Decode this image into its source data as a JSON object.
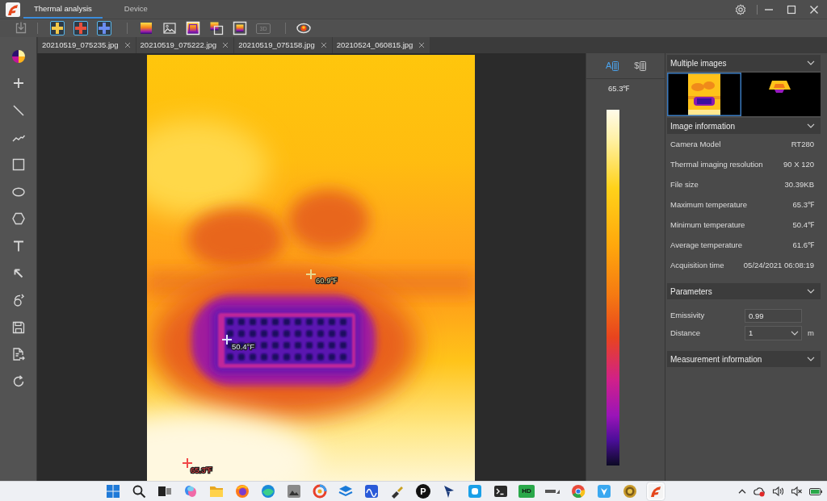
{
  "window": {
    "tabs": [
      {
        "label": "Thermal analysis",
        "selected": true
      },
      {
        "label": "Device",
        "selected": false
      }
    ]
  },
  "toolbar": {
    "groups": [
      {
        "buttons": [
          {
            "kind": "import",
            "disabled": true
          }
        ]
      },
      {
        "buttons": [
          {
            "kind": "add",
            "color": "#f2c84a",
            "disabled": false
          },
          {
            "kind": "add",
            "color": "#e8503c",
            "disabled": false
          },
          {
            "kind": "add",
            "color": "#6a8cf0",
            "disabled": false
          }
        ]
      },
      {
        "buttons": [
          {
            "kind": "palette",
            "disabled": false
          },
          {
            "kind": "image",
            "disabled": false
          },
          {
            "kind": "frame",
            "disabled": false
          },
          {
            "kind": "overlay",
            "disabled": false
          },
          {
            "kind": "inset",
            "disabled": false
          },
          {
            "kind": "badge",
            "label": "3D",
            "disabled": true
          }
        ]
      },
      {
        "buttons": [
          {
            "kind": "fusion",
            "disabled": false
          }
        ]
      }
    ]
  },
  "file_tabs": [
    {
      "label": "20210519_075235.jpg"
    },
    {
      "label": "20210519_075222.jpg"
    },
    {
      "label": "20210519_075158.jpg"
    },
    {
      "label": "20210524_060815.jpg"
    }
  ],
  "measurements": [
    {
      "kind": "center",
      "label": "60.9℉",
      "color": "#e8d890"
    },
    {
      "kind": "min",
      "label": "50.4°F",
      "color": "#dfe4ff"
    },
    {
      "kind": "max",
      "label": "65.3℉",
      "color": "#f04848"
    }
  ],
  "color_scale": {
    "modes": [
      {
        "label": "A",
        "selected": true
      },
      {
        "label": "$",
        "selected": false
      }
    ],
    "max_label": "65.3℉"
  },
  "side_panel": {
    "sections": [
      {
        "kind": "images",
        "title": "Multiple images",
        "thumbnails": [
          {
            "kind": "portrait",
            "selected": true
          },
          {
            "kind": "object",
            "selected": false
          }
        ]
      },
      {
        "kind": "info",
        "title": "Image information",
        "rows": [
          {
            "label": "Camera Model",
            "value": "RT280"
          },
          {
            "label": "Thermal imaging resolution",
            "value": "90 X 120"
          },
          {
            "label": "File size",
            "value": "30.39KB"
          },
          {
            "label": "Maximum temperature",
            "value": "65.3℉"
          },
          {
            "label": "Minimum temperature",
            "value": "50.4℉"
          },
          {
            "label": "Average temperature",
            "value": "61.6℉"
          },
          {
            "label": "Acquisition time",
            "value": "05/24/2021 06:08:19"
          }
        ]
      },
      {
        "kind": "params",
        "title": "Parameters",
        "fields": [
          {
            "kind": "input",
            "label": "Emissivity",
            "value": "0.99"
          },
          {
            "kind": "select",
            "label": "Distance",
            "value": "1",
            "unit": "m"
          }
        ]
      },
      {
        "kind": "measure",
        "title": "Measurement information"
      }
    ]
  },
  "taskbar": {
    "apps": [
      {
        "kind": "start",
        "selected": false
      },
      {
        "kind": "search",
        "selected": false
      },
      {
        "kind": "taskview",
        "selected": false
      },
      {
        "kind": "swirl",
        "selected": false
      },
      {
        "kind": "folder",
        "selected": false
      },
      {
        "kind": "foxglobe",
        "selected": false
      },
      {
        "kind": "waveglobe",
        "selected": false
      },
      {
        "kind": "picture",
        "selected": false
      },
      {
        "kind": "ring",
        "selected": false
      },
      {
        "kind": "layers",
        "selected": false
      },
      {
        "kind": "wavetile",
        "selected": false
      },
      {
        "kind": "tool",
        "selected": false
      },
      {
        "kind": "letter",
        "label": "P",
        "selected": false
      },
      {
        "kind": "sail",
        "selected": false
      },
      {
        "kind": "tile",
        "selected": false
      },
      {
        "kind": "terminal",
        "selected": false
      },
      {
        "kind": "badge",
        "label": "HD",
        "selected": false
      },
      {
        "kind": "wordmark",
        "selected": false
      },
      {
        "kind": "segmented",
        "selected": false
      },
      {
        "kind": "arrowtile",
        "selected": false
      },
      {
        "kind": "seal",
        "selected": false
      },
      {
        "kind": "logo",
        "selected": true
      }
    ]
  }
}
